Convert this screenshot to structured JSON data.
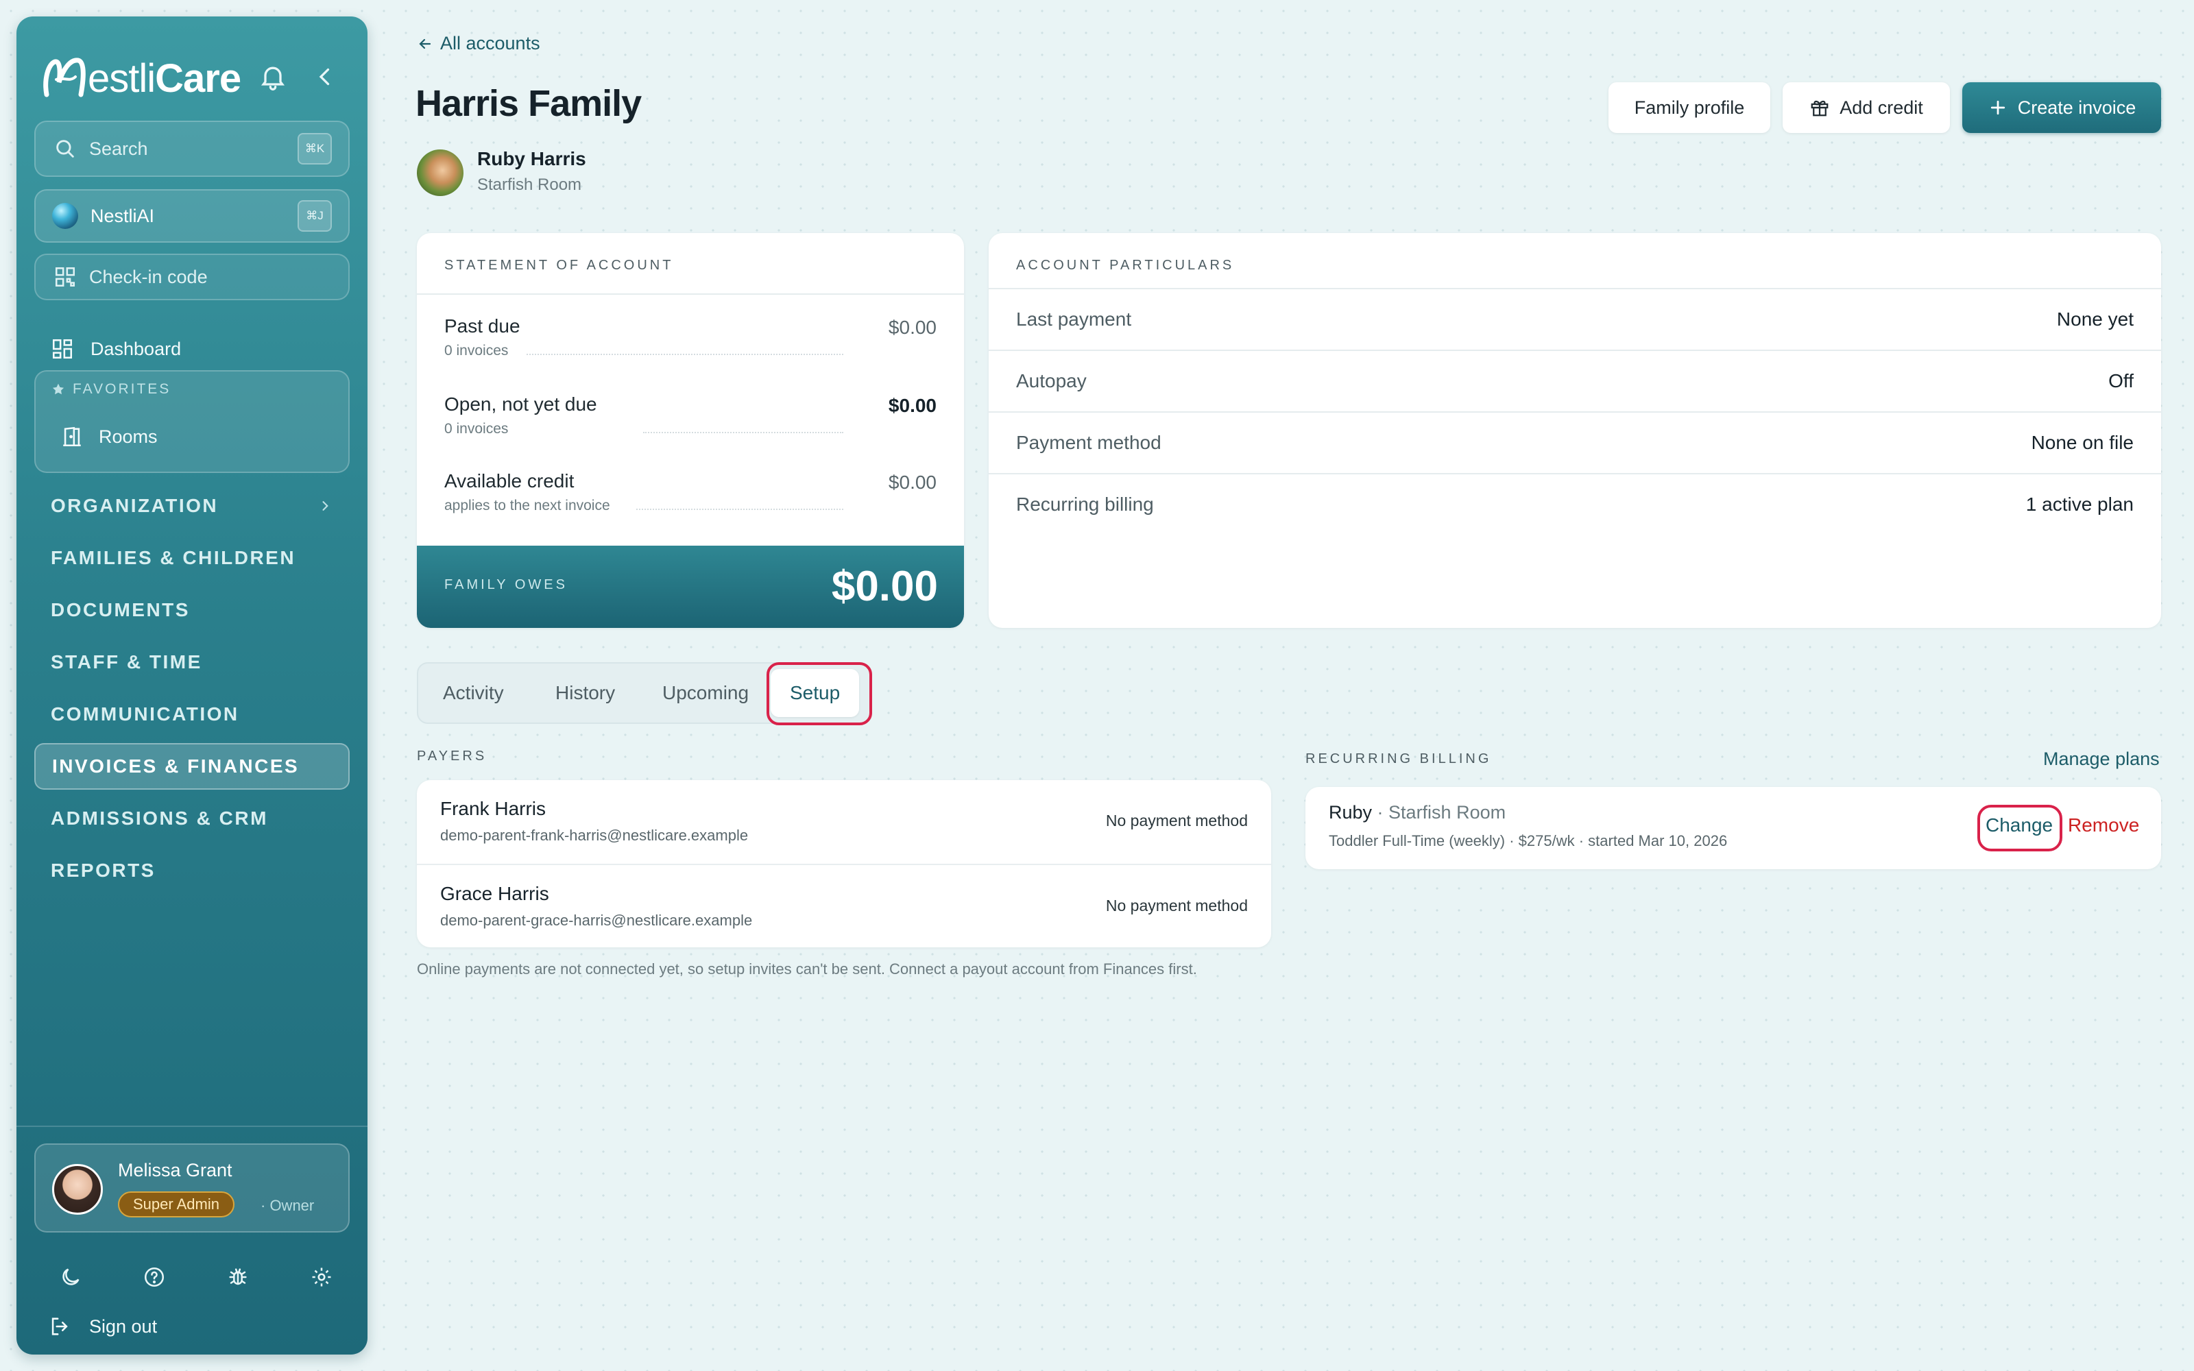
{
  "app": {
    "brand": {
      "letter": "N",
      "text_main": "estli",
      "text_bold": "Care"
    }
  },
  "sidebar": {
    "search": {
      "label": "Search",
      "shortcut": "⌘K"
    },
    "ai": {
      "label": "NestliAI",
      "shortcut": "⌘J"
    },
    "checkin": {
      "label": "Check-in code"
    },
    "dashboard": {
      "label": "Dashboard"
    },
    "favorites": {
      "heading": "FAVORITES",
      "items": [
        {
          "label": "Rooms"
        }
      ]
    },
    "nav": [
      {
        "label": "ORGANIZATION"
      },
      {
        "label": "FAMILIES & CHILDREN"
      },
      {
        "label": "DOCUMENTS"
      },
      {
        "label": "STAFF & TIME"
      },
      {
        "label": "COMMUNICATION"
      },
      {
        "label": "INVOICES & FINANCES"
      },
      {
        "label": "ADMISSIONS & CRM"
      },
      {
        "label": "REPORTS"
      }
    ],
    "user": {
      "name": "Melissa Grant",
      "role": "Super Admin",
      "sub": "· Owner"
    },
    "signout": "Sign out"
  },
  "header": {
    "back": "All accounts",
    "title": "Harris Family",
    "child": {
      "name": "Ruby Harris",
      "room": "Starfish Room"
    },
    "buttons": {
      "profile": "Family profile",
      "credit": "Add credit",
      "invoice": "Create invoice"
    }
  },
  "statement": {
    "heading": "STATEMENT OF ACCOUNT",
    "rows": [
      {
        "title": "Past due",
        "sub": "0 invoices",
        "value": "$0.00"
      },
      {
        "title": "Open, not yet due",
        "sub": "0 invoices",
        "value": "$0.00"
      },
      {
        "title": "Available credit",
        "sub": "applies to the next invoice",
        "value": "$0.00"
      }
    ],
    "owes_label": "FAMILY OWES",
    "owes_value": "$0.00"
  },
  "particulars": {
    "heading": "ACCOUNT PARTICULARS",
    "rows": [
      {
        "key": "Last payment",
        "value": "None yet"
      },
      {
        "key": "Autopay",
        "value": "Off"
      },
      {
        "key": "Payment method",
        "value": "None on file"
      },
      {
        "key": "Recurring billing",
        "value": "1 active plan"
      }
    ]
  },
  "tabs": [
    {
      "label": "Activity"
    },
    {
      "label": "History"
    },
    {
      "label": "Upcoming"
    },
    {
      "label": "Setup",
      "active": true
    }
  ],
  "payers": {
    "heading": "PAYERS",
    "items": [
      {
        "name": "Frank Harris",
        "email": "demo-parent-frank-harris@nestlicare.example",
        "method": "No payment method"
      },
      {
        "name": "Grace Harris",
        "email": "demo-parent-grace-harris@nestlicare.example",
        "method": "No payment method"
      }
    ],
    "note": "Online payments are not connected yet, so setup invites can't be sent. Connect a payout account from Finances first."
  },
  "recurring": {
    "heading": "RECURRING BILLING",
    "manage": "Manage plans",
    "plan": {
      "child": "Ruby",
      "room": "· Starfish Room",
      "detail": "Toddler Full-Time (weekly) · $275/wk · started Mar 10, 2026",
      "change": "Change",
      "remove": "Remove"
    }
  },
  "colors": {
    "accent": "#1f6c7b",
    "highlight": "#d9224a",
    "danger": "#cc2222"
  }
}
